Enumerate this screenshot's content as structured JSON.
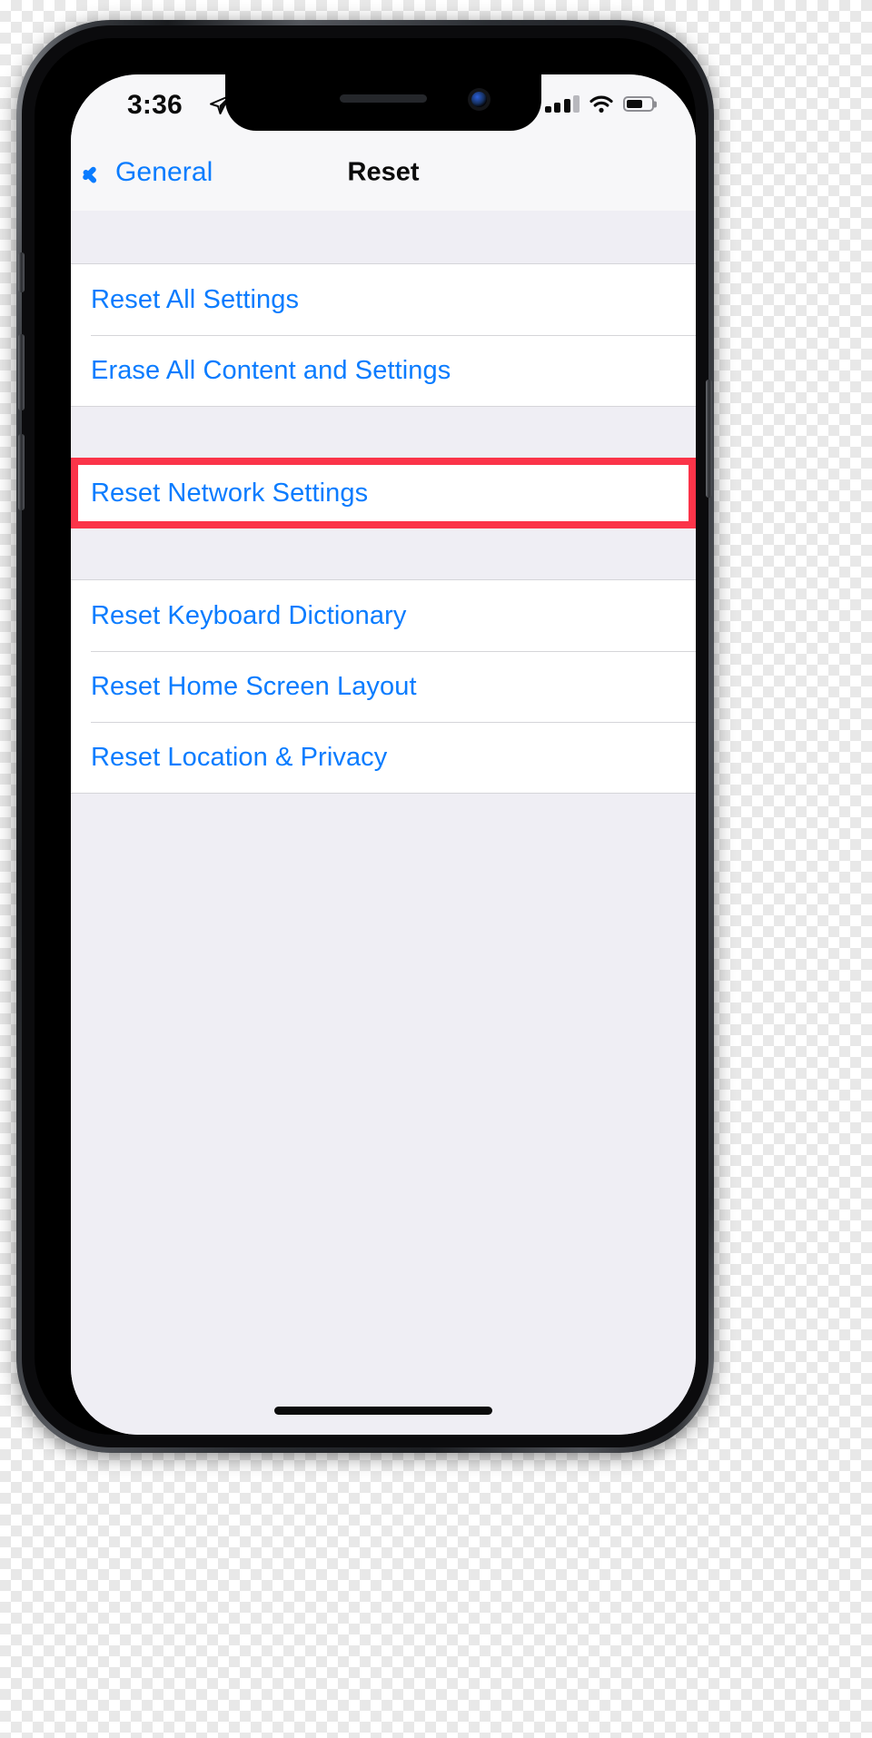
{
  "status_bar": {
    "time": "3:36",
    "location_icon": "location-arrow-icon",
    "signal_icon": "cellular-signal-icon",
    "signal_bars_filled": 3,
    "signal_bars_total": 4,
    "wifi_icon": "wifi-icon",
    "battery_icon": "battery-icon",
    "battery_level_percent": 65
  },
  "nav_bar": {
    "back_label": "General",
    "back_icon": "chevron-left-icon",
    "title": "Reset"
  },
  "groups": [
    {
      "highlighted": false,
      "rows": [
        {
          "label": "Reset All Settings"
        },
        {
          "label": "Erase All Content and Settings"
        }
      ]
    },
    {
      "highlighted": true,
      "rows": [
        {
          "label": "Reset Network Settings"
        }
      ]
    },
    {
      "highlighted": false,
      "rows": [
        {
          "label": "Reset Keyboard Dictionary"
        },
        {
          "label": "Reset Home Screen Layout"
        },
        {
          "label": "Reset Location & Privacy"
        }
      ]
    }
  ],
  "colors": {
    "accent_blue": "#0a7cff",
    "highlight_red": "#fb3449",
    "background_gray": "#efeef4",
    "row_white": "#ffffff",
    "separator": "#d5d5d9",
    "bar_gray": "#f7f7f9",
    "text_black": "#0b0b0b"
  },
  "home_indicator": "home-indicator"
}
